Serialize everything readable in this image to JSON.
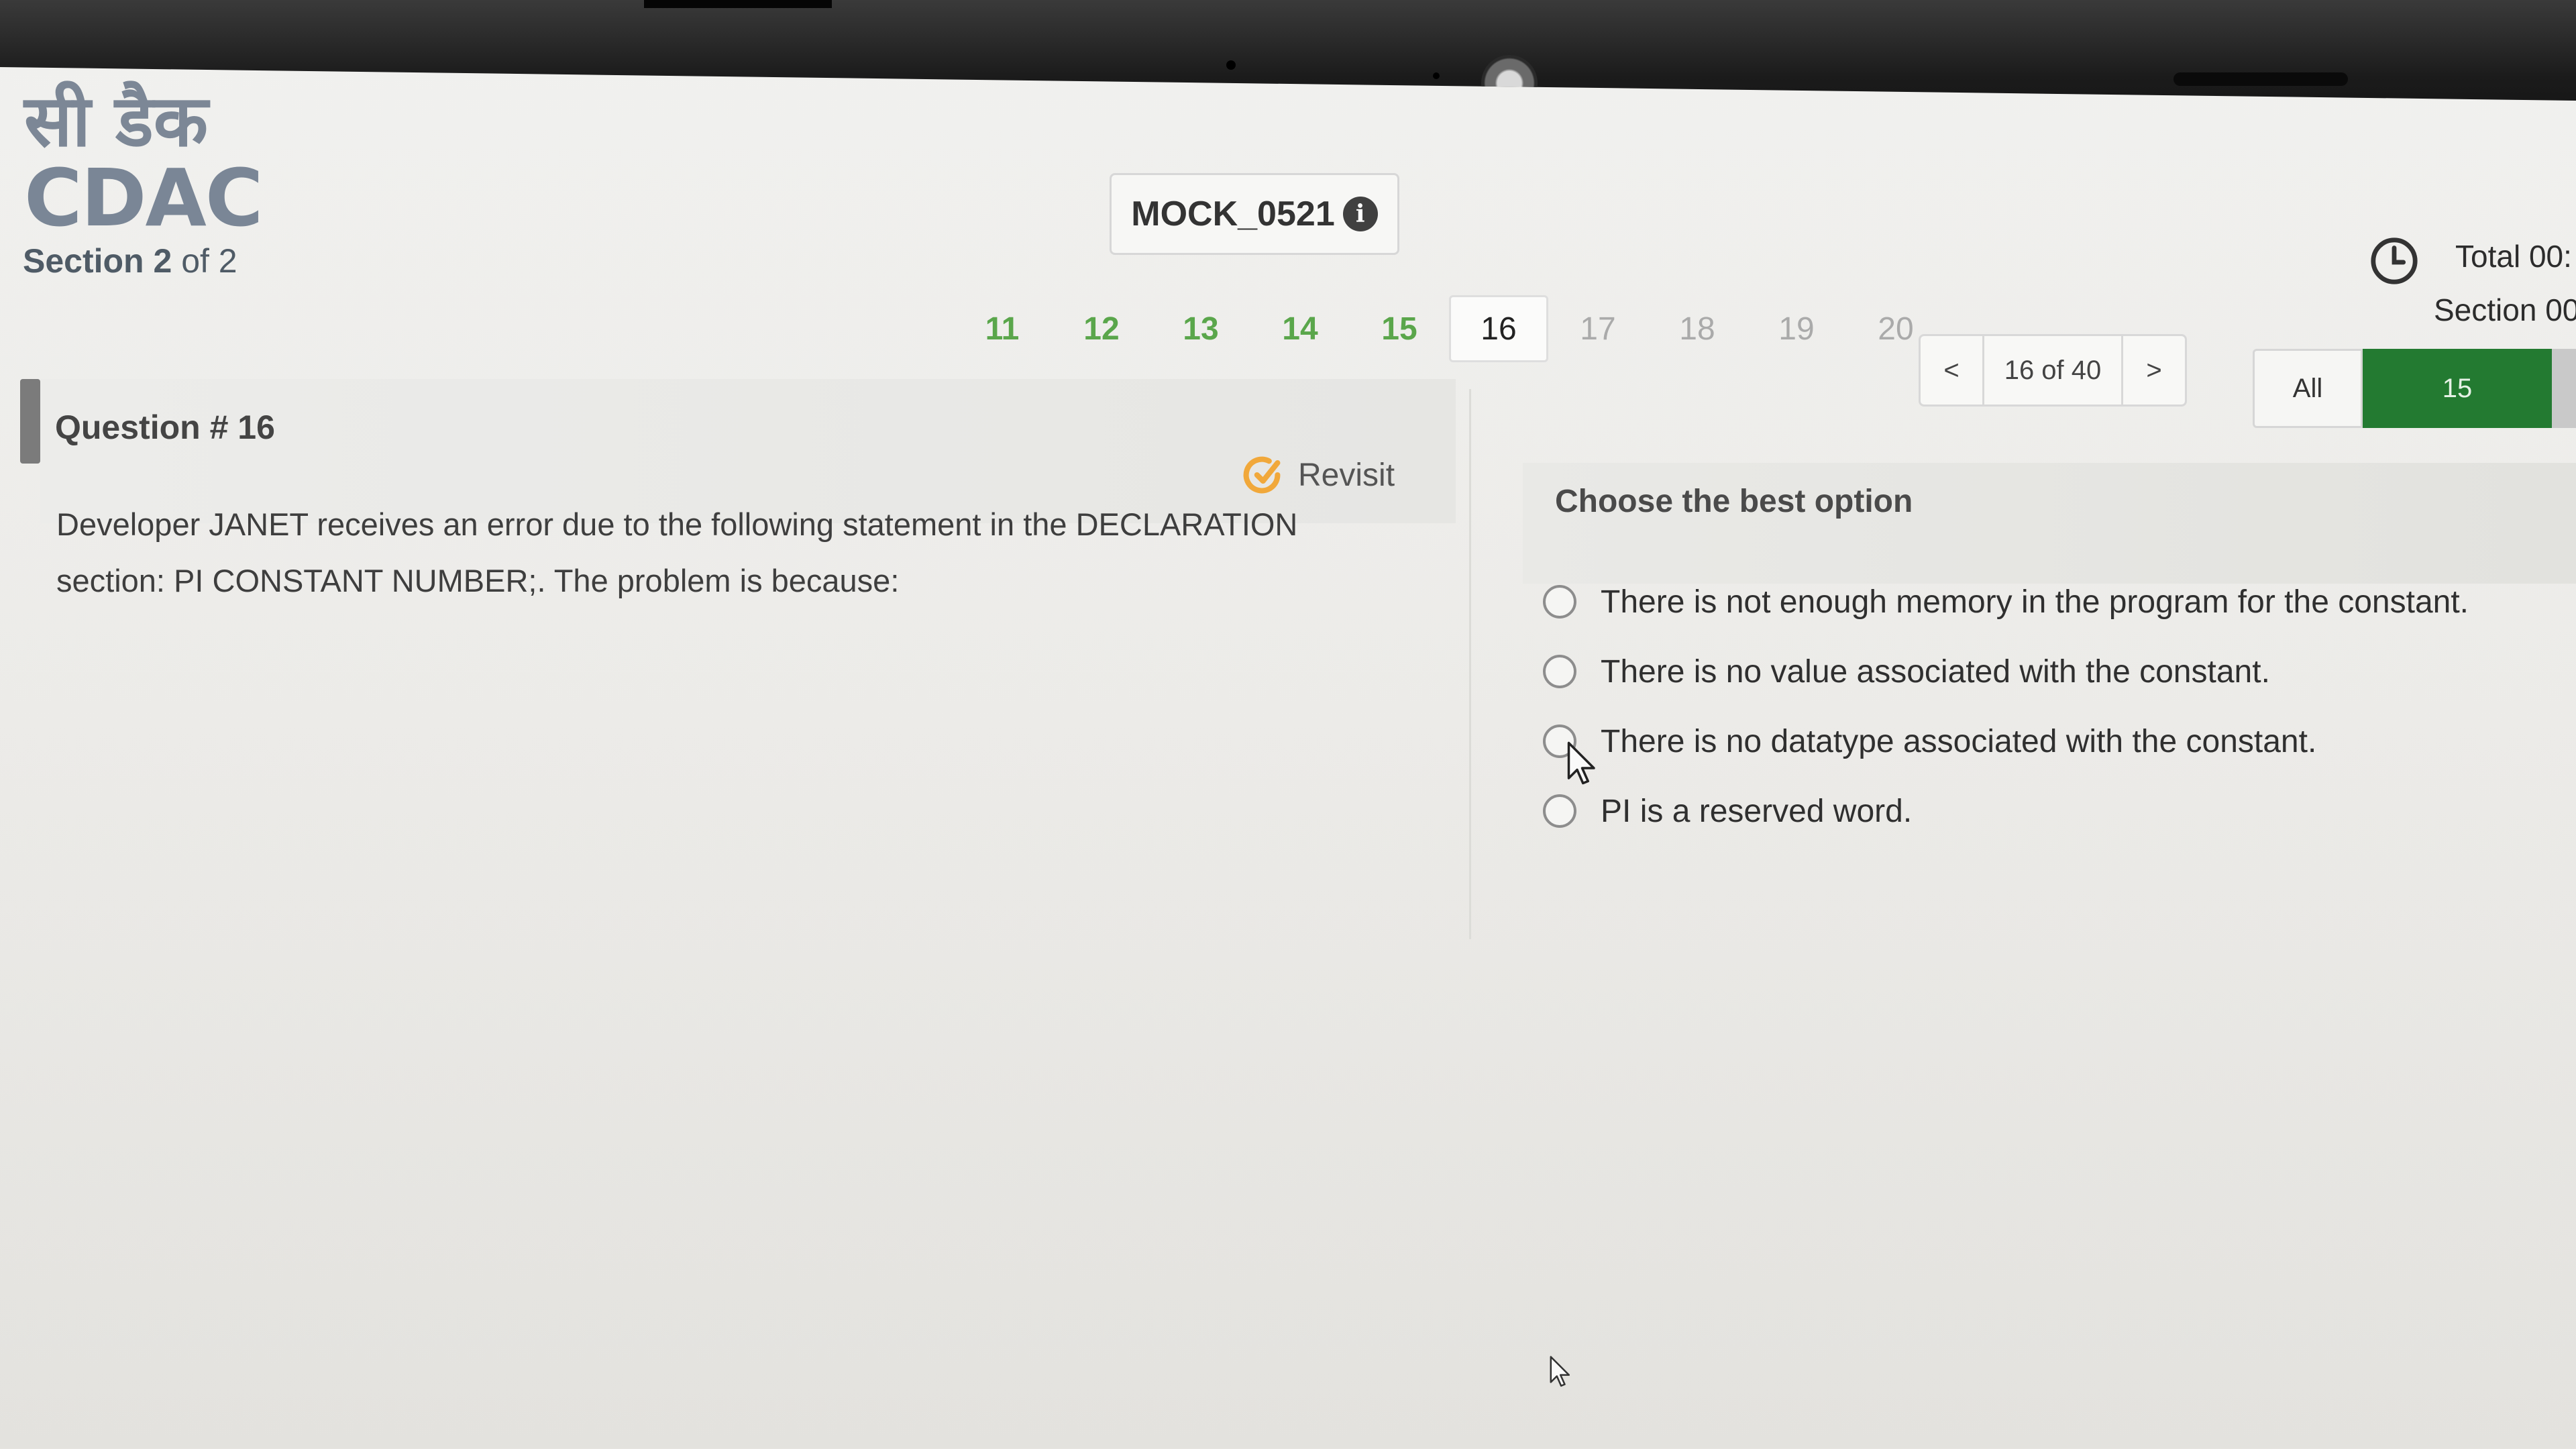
{
  "logo": {
    "hindi": "सी डैक",
    "latin": "CDAC"
  },
  "section": {
    "prefix": "Section 2",
    "suffix": " of 2"
  },
  "exam": {
    "title": "MOCK_0521",
    "info_icon": "info-icon"
  },
  "timer": {
    "icon": "clock-icon",
    "total_label": "Total 00:",
    "section_label": "Section 00"
  },
  "pagination": {
    "pages": [
      {
        "label": "11",
        "state": "answered"
      },
      {
        "label": "12",
        "state": "answered"
      },
      {
        "label": "13",
        "state": "answered"
      },
      {
        "label": "14",
        "state": "answered"
      },
      {
        "label": "15",
        "state": "answered"
      },
      {
        "label": "16",
        "state": "current"
      },
      {
        "label": "17",
        "state": "unvisited"
      },
      {
        "label": "18",
        "state": "unvisited"
      },
      {
        "label": "19",
        "state": "unvisited"
      },
      {
        "label": "20",
        "state": "unvisited"
      }
    ],
    "prev": "<",
    "count": "16 of 40",
    "next": ">"
  },
  "filter": {
    "all_label": "All",
    "answered_count": "15",
    "answered_color": "#237a31"
  },
  "question": {
    "number_label": "Question # 16",
    "revisit_label": "Revisit",
    "text": "Developer JANET receives an error due to the following statement in the DECLARATION section: PI CONSTANT NUMBER;. The problem is because:"
  },
  "options": {
    "title": "Choose the best option",
    "items": [
      "There is not enough memory in the program for the constant.",
      "There is no value associated with the constant.",
      "There is no datatype associated with the constant.",
      "PI is a reserved word."
    ]
  }
}
